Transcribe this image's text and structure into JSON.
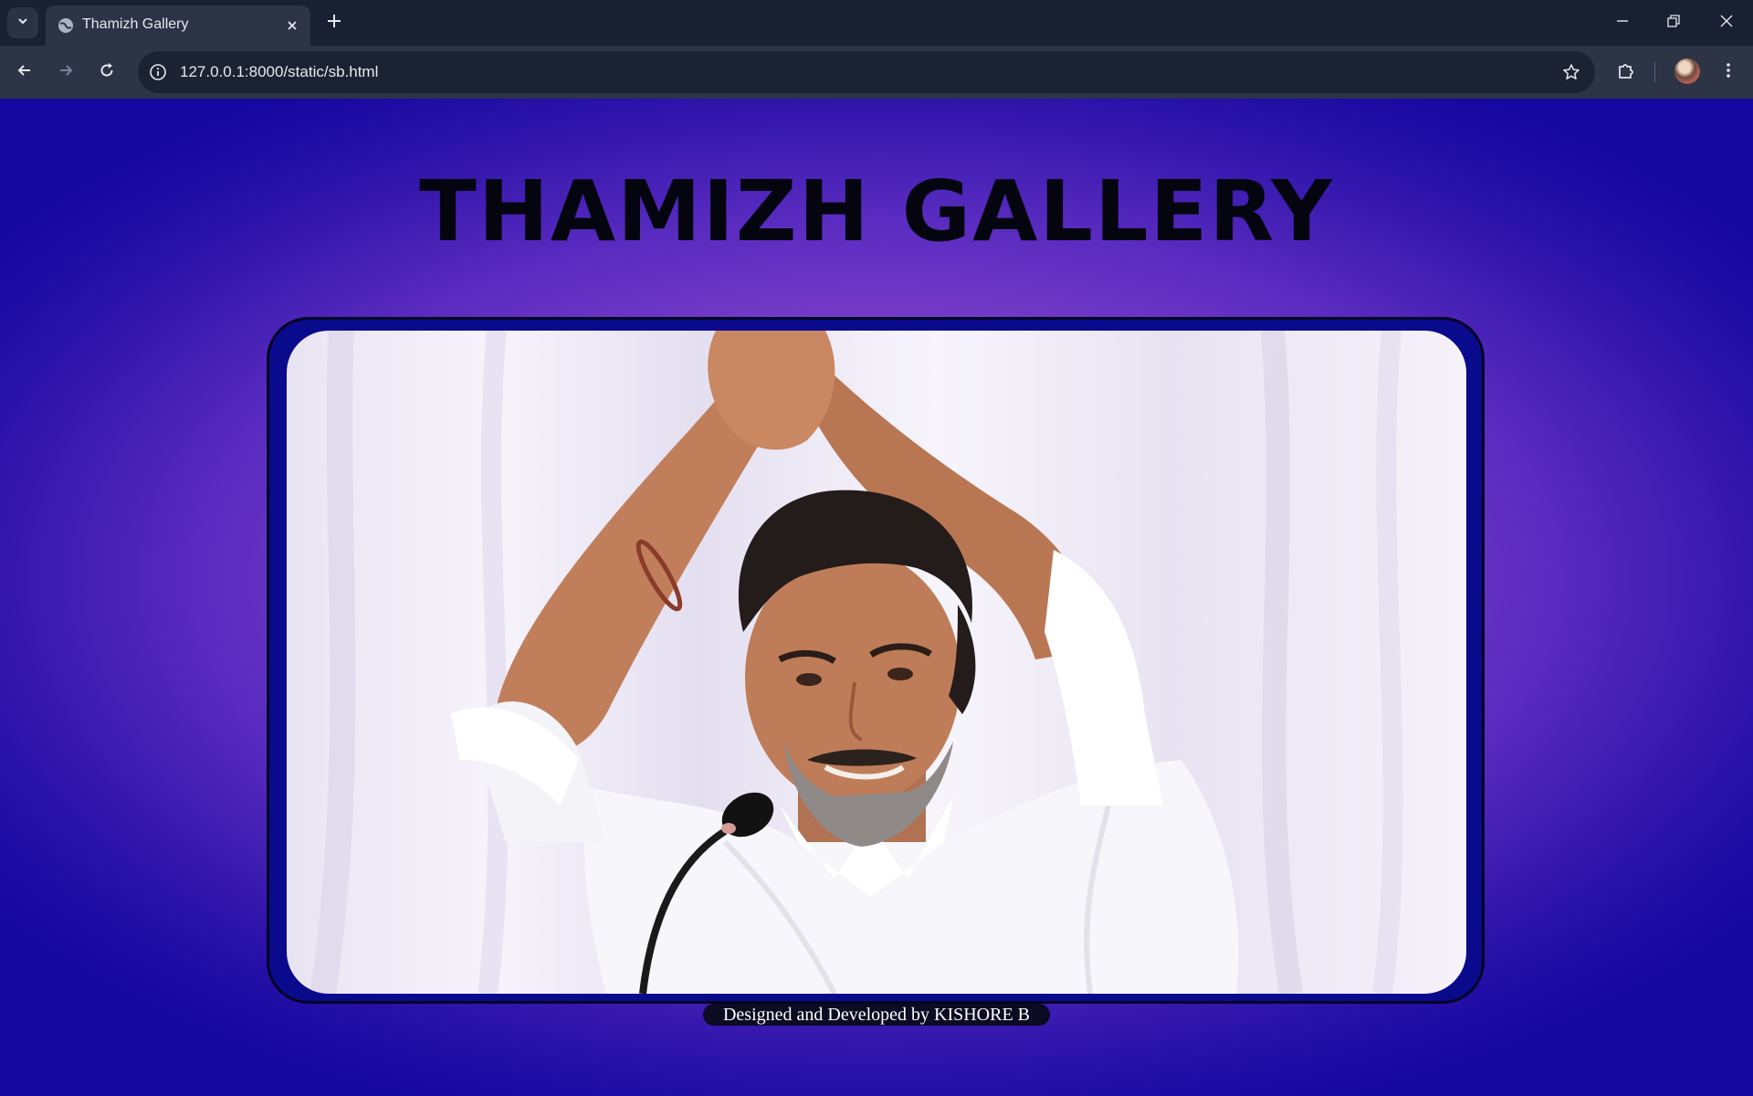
{
  "browser": {
    "tab_title": "Thamizh Gallery",
    "url": "127.0.0.1:8000/static/sb.html",
    "icons": [
      "tab-search-icon",
      "globe-icon",
      "close-icon",
      "plus-icon",
      "minimize-icon",
      "restore-icon",
      "window-close-icon",
      "back-icon",
      "forward-icon",
      "reload-icon",
      "info-icon",
      "star-icon",
      "extensions-icon",
      "menu-icon"
    ]
  },
  "page": {
    "heading": "THAMIZH GALLERY",
    "credit": "Designed and Developed by KISHORE B",
    "colors": {
      "background_center": "#a14fcf",
      "background_edge": "#1507a0",
      "frame": "#0a0a8c",
      "heading": "#050510"
    }
  }
}
